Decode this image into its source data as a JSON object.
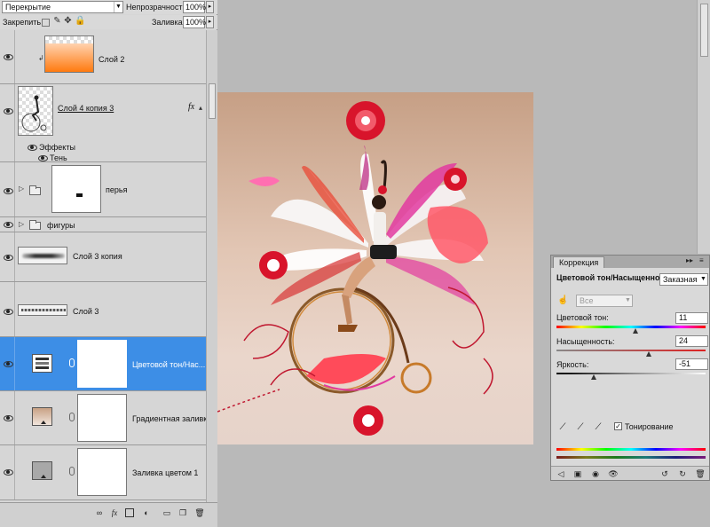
{
  "layers_panel": {
    "blend_mode": "Перекрытие",
    "opacity_label": "Непрозрачность:",
    "opacity_value": "100%",
    "lock_label": "Закрепить:",
    "fill_label": "Заливка:",
    "fill_value": "100%",
    "layers": [
      {
        "name": "Слой 2"
      },
      {
        "name": "Слой 4 копия 3"
      },
      {
        "name": "Эффекты"
      },
      {
        "name": "Тень"
      },
      {
        "name": "перья"
      },
      {
        "name": "фигуры"
      },
      {
        "name": "Слой 3 копия"
      },
      {
        "name": "Слой 3"
      },
      {
        "name": "Цветовой тон/Нас..."
      },
      {
        "name": "Градиентная заливк..."
      },
      {
        "name": "Заливка цветом 1"
      }
    ],
    "footer_icons": [
      "link-icon",
      "fx-icon",
      "mask-icon",
      "adjustment-icon",
      "folder-icon",
      "new-layer-icon",
      "trash-icon"
    ]
  },
  "correction_panel": {
    "tab_label": "Коррекция",
    "title": "Цветовой тон/Насыщенность",
    "preset": "Заказная",
    "channel": "Все",
    "hue_label": "Цветовой тон:",
    "hue_value": "11",
    "hue_level": 0.53,
    "saturation_label": "Насыщенность:",
    "saturation_value": "24",
    "saturation_level": 0.62,
    "lightness_label": "Яркость:",
    "lightness_value": "-51",
    "lightness_level": 0.25,
    "colorize_label": "Тонирование",
    "colorize_checked": true
  },
  "colors": {
    "selection": "#3d8ee6",
    "panel_bg": "#d6d6d6",
    "workspace_bg": "#b9b9b9"
  }
}
